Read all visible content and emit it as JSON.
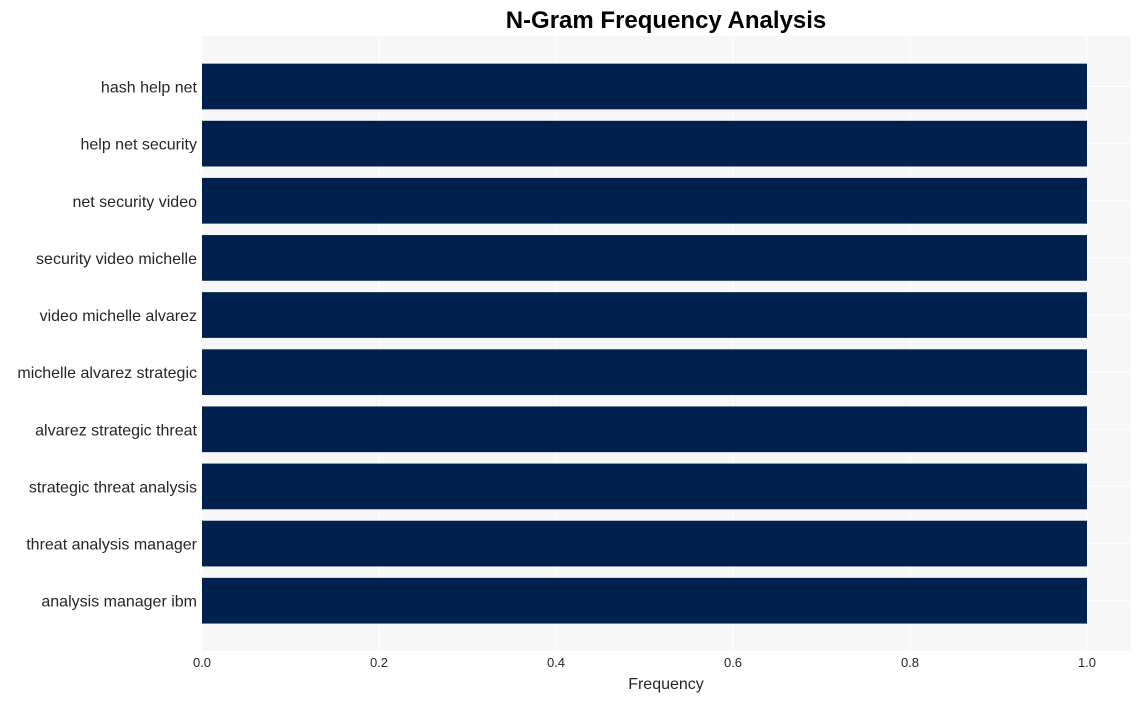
{
  "chart_data": {
    "type": "bar",
    "orientation": "horizontal",
    "title": "N-Gram Frequency Analysis",
    "xlabel": "Frequency",
    "ylabel": "",
    "categories": [
      "hash help net",
      "help net security",
      "net security video",
      "security video michelle",
      "video michelle alvarez",
      "michelle alvarez strategic",
      "alvarez strategic threat",
      "strategic threat analysis",
      "threat analysis manager",
      "analysis manager ibm"
    ],
    "values": [
      1,
      1,
      1,
      1,
      1,
      1,
      1,
      1,
      1,
      1
    ],
    "xlim": [
      0,
      1.05
    ],
    "xticks": [
      "0.0",
      "0.2",
      "0.4",
      "0.6",
      "0.8",
      "1.0"
    ],
    "xtick_values": [
      0,
      0.2,
      0.4,
      0.6,
      0.8,
      1.0
    ],
    "grid": true,
    "legend": "none",
    "colors": {
      "bar": "#00214e",
      "plot_background": "#f7f7f7",
      "grid": "#ffffff",
      "text": "#262626"
    }
  }
}
